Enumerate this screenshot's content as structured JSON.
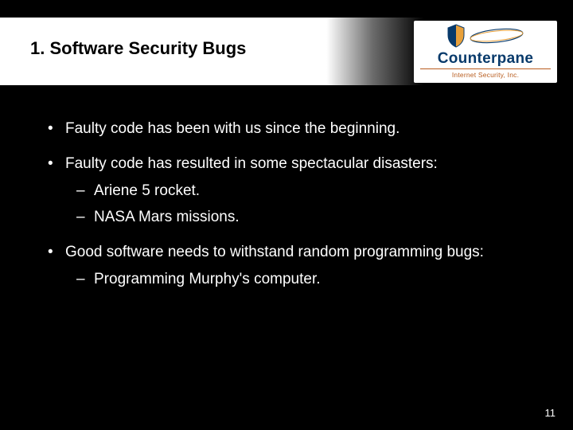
{
  "title": "1.  Software Security Bugs",
  "logo": {
    "name": "Counterpane",
    "sub": "Internet Security, Inc."
  },
  "bullets": {
    "b1": "Faulty code has been with us since the beginning.",
    "b2": "Faulty code has resulted in some spectacular disasters:",
    "b2_sub": {
      "s1": "Ariene 5 rocket.",
      "s2": "NASA Mars missions."
    },
    "b3": "Good software needs to withstand random programming bugs:",
    "b3_sub": {
      "s1": "Programming Murphy's computer."
    }
  },
  "page_number": "11"
}
